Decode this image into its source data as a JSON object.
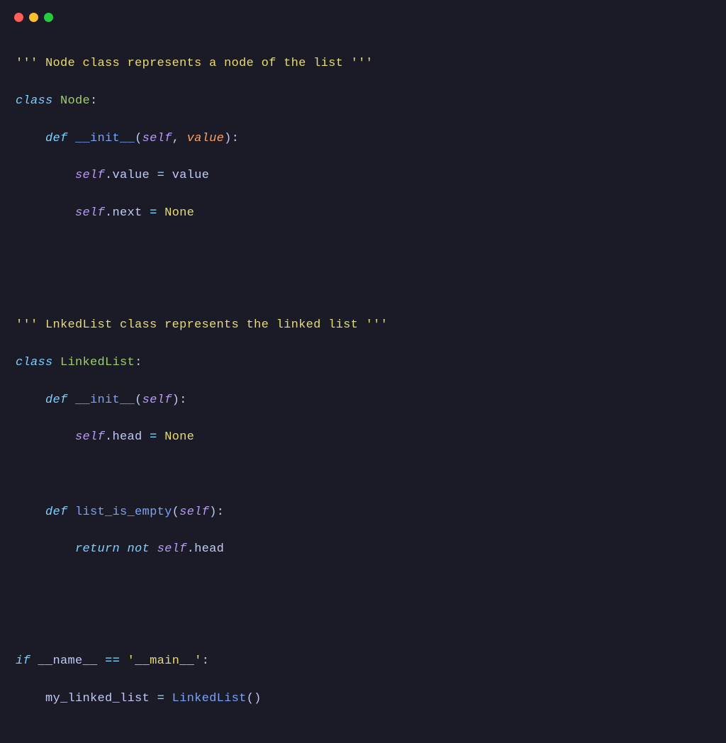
{
  "code": {
    "line1_comment_open": "''' ",
    "line1_comment_text": "Node class represents a node of the list",
    "line1_comment_close": " '''",
    "line2_class_kw": "class",
    "line2_class_name": "Node",
    "line3_def_kw": "def",
    "line3_func_name": "__init__",
    "line3_self": "self",
    "line3_param": "value",
    "line4_self": "self",
    "line4_attr": "value",
    "line4_rhs": "value",
    "line5_self": "self",
    "line5_attr": "next",
    "line5_rhs": "None",
    "line6_comment_open": "''' ",
    "line6_comment_text": "LnkedList class represents the linked list",
    "line6_comment_close": " '''",
    "line7_class_kw": "class",
    "line7_class_name": "LinkedList",
    "line8_def_kw": "def",
    "line8_func_name": "__init__",
    "line8_self": "self",
    "line9_self": "self",
    "line9_attr": "head",
    "line9_rhs": "None",
    "line10_def_kw": "def",
    "line10_func_name": "list_is_empty",
    "line10_self": "self",
    "line11_return_kw": "return",
    "line11_not_kw": "not",
    "line11_self": "self",
    "line11_attr": "head",
    "line12_if_kw": "if",
    "line12_name": "__name__",
    "line12_eq": "==",
    "line12_str": "'__main__'",
    "line13_var": "my_linked_list",
    "line13_call": "LinkedList"
  }
}
